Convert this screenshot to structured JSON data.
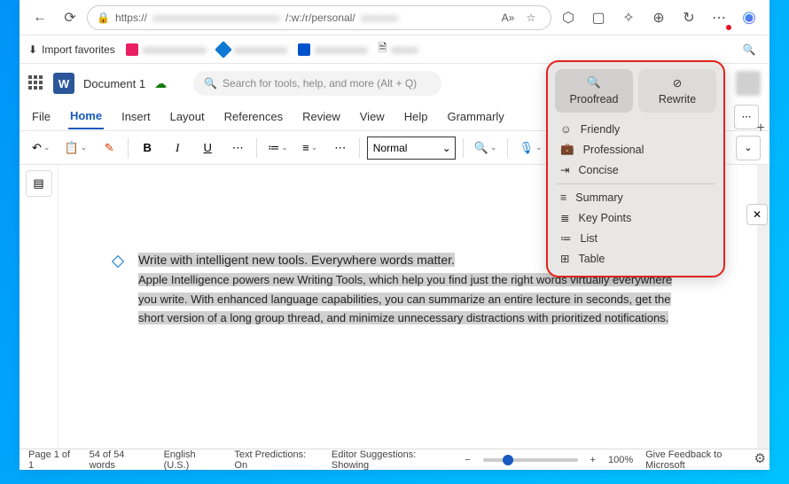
{
  "browser": {
    "url_prefix": "https://",
    "url_mid": "/:w:/r/personal/",
    "bookmarks": {
      "import": "Import favorites"
    }
  },
  "word": {
    "doc_name": "Document 1",
    "search_placeholder": "Search for tools, help, and more (Alt + Q)",
    "tabs": [
      "File",
      "Home",
      "Insert",
      "Layout",
      "References",
      "Review",
      "View",
      "Help",
      "Grammarly"
    ],
    "style": "Normal"
  },
  "document": {
    "title": "Write with intelligent new tools. Everywhere words matter.  ",
    "body": "Apple Intelligence powers new Writing Tools, which help you find just the right words virtually everywhere you write. With enhanced language capabilities, you can summarize an entire lecture in seconds, get the short version of a long group thread, and minimize unnecessary distractions with prioritized notifications."
  },
  "popup": {
    "proofread": "Proofread",
    "rewrite": "Rewrite",
    "tones": [
      "Friendly",
      "Professional",
      "Concise"
    ],
    "ops": [
      "Summary",
      "Key Points",
      "List",
      "Table"
    ]
  },
  "status": {
    "page": "Page 1 of 1",
    "words": "54 of 54 words",
    "lang": "English (U.S.)",
    "pred": "Text Predictions: On",
    "sugg": "Editor Suggestions: Showing",
    "zoom": "100%",
    "feedback": "Give Feedback to Microsoft"
  }
}
